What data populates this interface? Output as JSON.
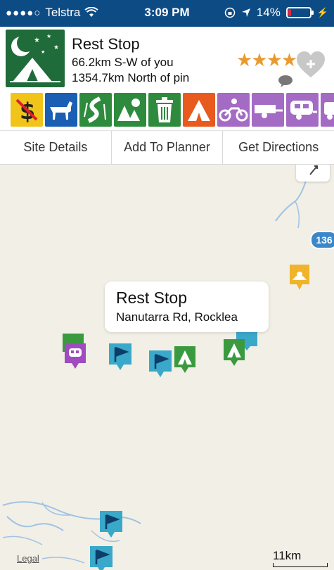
{
  "status_bar": {
    "carrier": "Telstra",
    "time": "3:09 PM",
    "battery": "14%",
    "battery_level": 0.14
  },
  "site": {
    "title": "Rest Stop",
    "distance": "66.2km S-W of you",
    "pin_distance": "1354.7km North of pin",
    "rating": 4,
    "stars": "★★★★"
  },
  "amenities": [
    {
      "icon": "no-fee-icon",
      "color": "#f0c419"
    },
    {
      "icon": "dog-icon",
      "color": "#1a5fb4"
    },
    {
      "icon": "scenic-road-icon",
      "color": "#2e8b3d"
    },
    {
      "icon": "bush-camping-icon",
      "color": "#2e8b3d"
    },
    {
      "icon": "bin-icon",
      "color": "#2e8b3d"
    },
    {
      "icon": "tent-icon",
      "color": "#e85a1e"
    },
    {
      "icon": "motorbike-icon",
      "color": "#a46bc4"
    },
    {
      "icon": "trailer-icon",
      "color": "#a46bc4"
    },
    {
      "icon": "caravan-icon",
      "color": "#a46bc4"
    },
    {
      "icon": "motorhome-icon",
      "color": "#a46bc4"
    }
  ],
  "tabs": {
    "site_details": "Site Details",
    "add_to_planner": "Add To Planner",
    "get_directions": "Get Directions"
  },
  "map": {
    "callout_title": "Rest Stop",
    "callout_subtitle": "Nanutarra Rd, Rocklea",
    "road_shield": "136",
    "legal": "Legal",
    "scale": "11km"
  }
}
